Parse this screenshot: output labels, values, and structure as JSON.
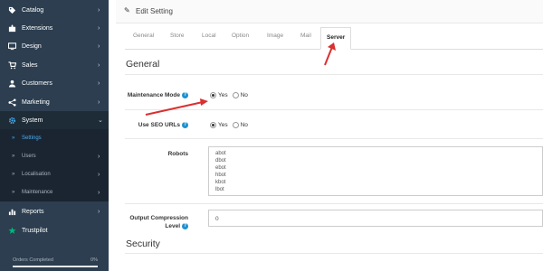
{
  "sidebar": {
    "items": [
      {
        "label": "Catalog",
        "icon": "tag-icon"
      },
      {
        "label": "Extensions",
        "icon": "puzzle-icon"
      },
      {
        "label": "Design",
        "icon": "monitor-icon"
      },
      {
        "label": "Sales",
        "icon": "cart-icon"
      },
      {
        "label": "Customers",
        "icon": "user-icon"
      },
      {
        "label": "Marketing",
        "icon": "share-icon"
      },
      {
        "label": "System",
        "icon": "gear-icon"
      }
    ],
    "subitems": [
      {
        "label": "Settings"
      },
      {
        "label": "Users"
      },
      {
        "label": "Localisation"
      },
      {
        "label": "Maintenance"
      }
    ],
    "bottom_items": [
      {
        "label": "Reports",
        "icon": "bar-chart-icon"
      },
      {
        "label": "Trustpilot",
        "icon": "star-icon"
      }
    ],
    "progress": {
      "label": "Orders Completed",
      "percent_text": "0%",
      "value": 0
    }
  },
  "header": {
    "title": "Edit Setting"
  },
  "tabs": [
    "General",
    "Store",
    "Local",
    "Option",
    "Image",
    "Mail",
    "Server"
  ],
  "sections": {
    "general": "General",
    "security": "Security"
  },
  "form": {
    "maintenance": {
      "label": "Maintenance Mode",
      "yes": "Yes",
      "no": "No",
      "value": "Yes"
    },
    "seo": {
      "label": "Use SEO URLs",
      "yes": "Yes",
      "no": "No",
      "value": "Yes"
    },
    "robots": {
      "label": "Robots",
      "lines": [
        "abot",
        "dbot",
        "ebot",
        "hbot",
        "kbot",
        "lbot"
      ]
    },
    "compression": {
      "label_line1": "Output Compression",
      "label_line2": "Level",
      "value": "0"
    }
  },
  "colors": {
    "sidebar": "#2c3e50",
    "accent": "#1e91cf",
    "active_link": "#48b0f7",
    "arrow": "#d93030"
  }
}
